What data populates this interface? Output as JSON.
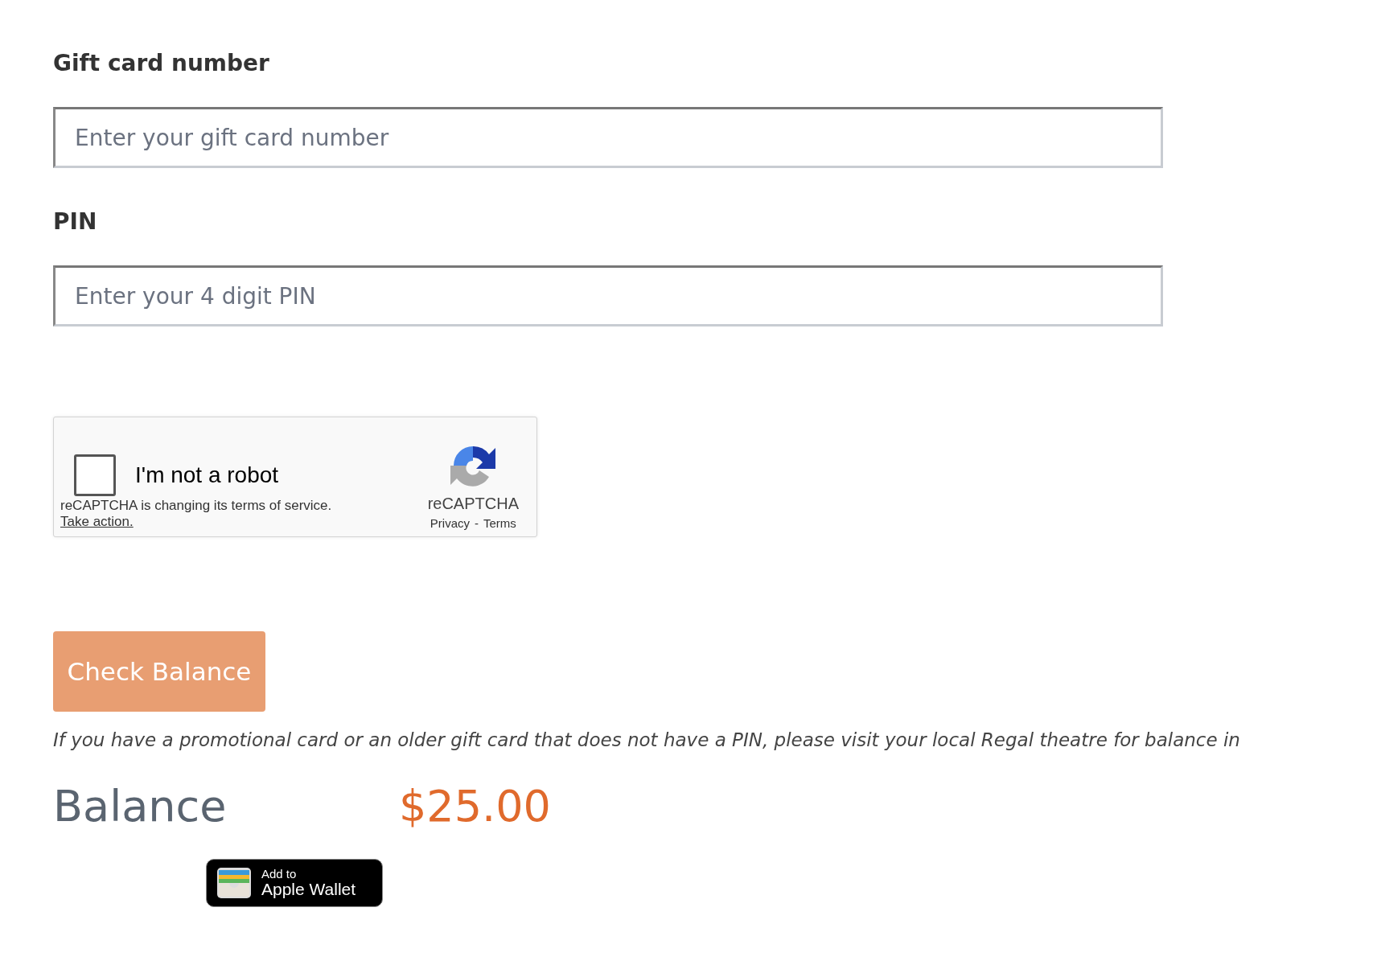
{
  "fields": [
    {
      "label": "Gift card number",
      "placeholder": "Enter your gift card number"
    },
    {
      "label": "PIN",
      "placeholder": "Enter your 4 digit PIN"
    }
  ],
  "captcha": {
    "checked": false,
    "label": "I'm not a robot",
    "notice": "reCAPTCHA is changing its terms of service.",
    "notice_link": "Take action.",
    "brand": "reCAPTCHA",
    "links": [
      "Privacy",
      "Terms"
    ],
    "separator": "-"
  },
  "submit_button": "Check Balance",
  "note": "If you have a promotional card or an older gift card that does not have a PIN, please visit your local Regal theatre for balance in",
  "balance": {
    "label": "Balance",
    "amount": "$25.00"
  },
  "wallet_button": {
    "line_1": "Add to",
    "line_2": "Apple Wallet"
  }
}
